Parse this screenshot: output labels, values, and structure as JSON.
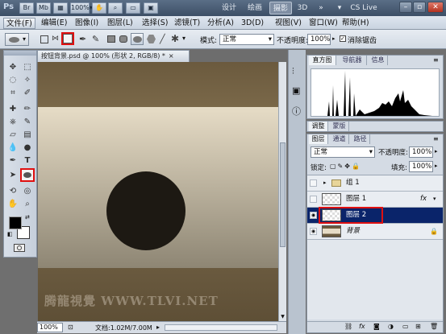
{
  "app": {
    "logo": "Ps",
    "bridge_label": "Br",
    "minibridge_label": "Mb",
    "workspaces": [
      "设计",
      "绘画",
      "摄影",
      "3D",
      "»"
    ],
    "active_workspace": "摄影",
    "cslive": "CS Live"
  },
  "menu": [
    "文件(F)",
    "编辑(E)",
    "图像(I)",
    "图层(L)",
    "选择(S)",
    "滤镜(T)",
    "分析(A)",
    "3D(D)",
    "视图(V)",
    "窗口(W)",
    "帮助(H)"
  ],
  "options": {
    "mode_label": "模式:",
    "mode_value": "正常",
    "opacity_label": "不透明度:",
    "opacity_value": "100%",
    "antialias_label": "消除锯齿"
  },
  "document": {
    "tab_title": "按钮背景.psd @ 100% (形状 2, RGB/8) *",
    "zoom": "100%",
    "doc_info": "文档:1.02M/7.00M",
    "watermark": "腾龍視覺 WWW.TLVI.NET",
    "colors": {
      "top_band": "#6b5a3e",
      "mid_top": "#e6dcc6",
      "mid_bottom": "#8e8674",
      "bottom_band": "#6a5a3f",
      "circle": "#1d1913"
    }
  },
  "histogram_panel": {
    "tabs": [
      "直方图",
      "导航器",
      "信息"
    ]
  },
  "adjust_panel": {
    "tabs": [
      "调整",
      "蒙版"
    ]
  },
  "layers_panel": {
    "tabs": [
      "图层",
      "通道",
      "路径"
    ],
    "blend": "正常",
    "opacity_label": "不透明度:",
    "opacity_value": "100%",
    "lock_label": "锁定:",
    "fill_label": "填充:",
    "fill_value": "100%",
    "layers": [
      {
        "name": "组 1",
        "type": "group"
      },
      {
        "name": "图层 1",
        "type": "layer",
        "fx": "fx"
      },
      {
        "name": "图层 2",
        "type": "layer",
        "selected": true
      },
      {
        "name": "背景",
        "type": "background"
      }
    ]
  }
}
